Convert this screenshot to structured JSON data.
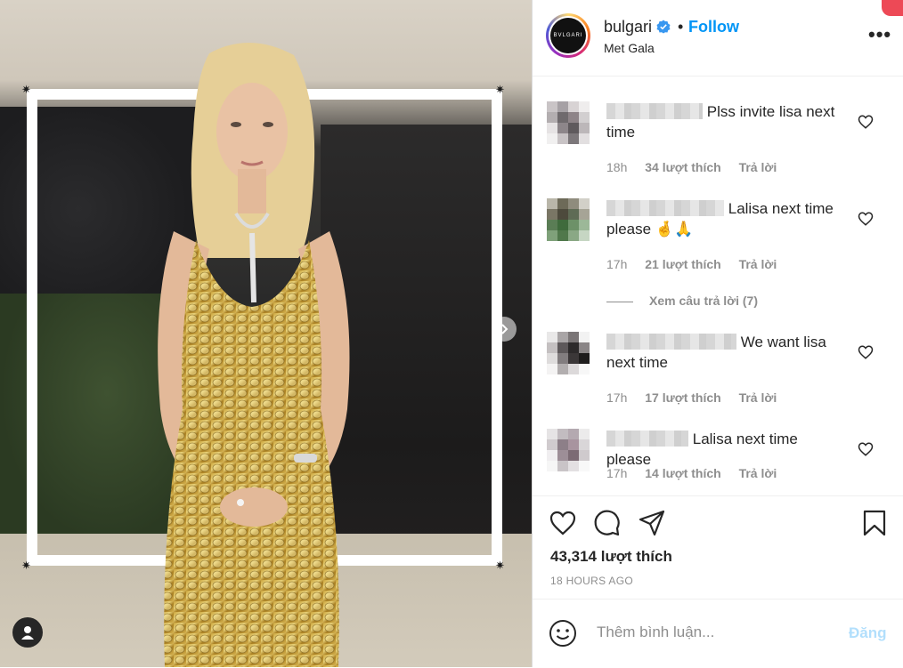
{
  "header": {
    "username": "bulgari",
    "separator": "•",
    "follow_label": "Follow",
    "location": "Met Gala",
    "avatar_text": "BVLGARI",
    "more_icon": "more-horizontal-icon"
  },
  "comments": [
    {
      "text": "Plss invite lisa next time",
      "time": "18h",
      "likes": "34 lượt thích",
      "reply": "Trả lời"
    },
    {
      "text": "Lalisa next time please 🤞🙏",
      "time": "17h",
      "likes": "21 lượt thích",
      "reply": "Trả lời"
    },
    {
      "text": "We want lisa next time",
      "time": "17h",
      "likes": "17 lượt thích",
      "reply": "Trả lời"
    },
    {
      "text": "Lalisa next time please",
      "time": "17h",
      "likes": "14 lượt thích",
      "reply": "Trả lời"
    }
  ],
  "view_replies": "Xem câu trả lời (7)",
  "actions": {
    "like_icon": "heart-icon",
    "comment_icon": "comment-icon",
    "share_icon": "share-icon",
    "save_icon": "bookmark-icon",
    "likes_count": "43,314 lượt thích",
    "posted": "18 HOURS AGO"
  },
  "composer": {
    "placeholder": "Thêm bình luận...",
    "post_label": "Đăng",
    "emoji_icon": "emoji-icon"
  },
  "colors": {
    "accent": "#0095f6",
    "muted": "#8e8e8e",
    "text": "#262626",
    "post_disabled": "#b2dffc"
  }
}
